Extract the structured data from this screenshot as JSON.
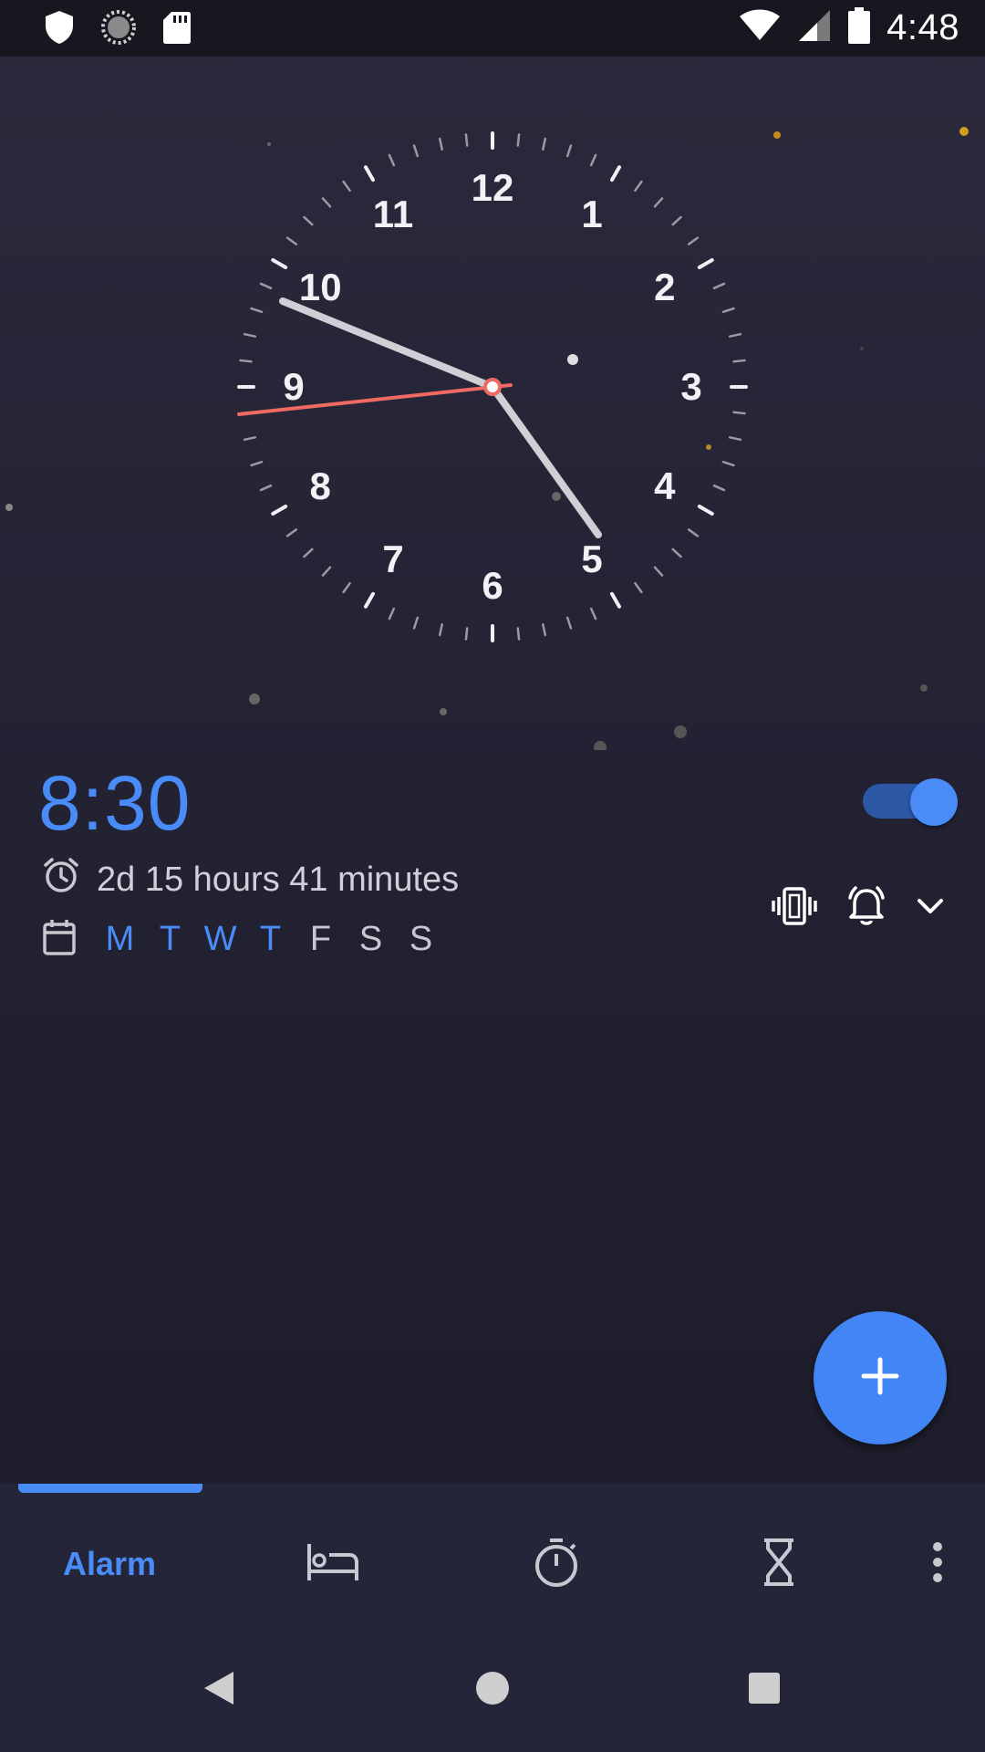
{
  "status_bar": {
    "time": "4:48",
    "left_icons": [
      "shield-icon",
      "sync-icon",
      "sd-card-icon"
    ],
    "right_icons": [
      "wifi-icon",
      "cell-signal-icon",
      "battery-icon"
    ]
  },
  "clock": {
    "numbers": [
      "12",
      "1",
      "2",
      "3",
      "4",
      "5",
      "6",
      "7",
      "8",
      "9",
      "10",
      "11"
    ],
    "hour_hand_color": "#cfcfd6",
    "second_hand_color": "#ef6a62"
  },
  "alarm": {
    "time": "8:30",
    "enabled": true,
    "remaining": "2d 15 hours 41 minutes",
    "days": [
      {
        "label": "M",
        "on": true
      },
      {
        "label": "T",
        "on": true
      },
      {
        "label": "W",
        "on": true
      },
      {
        "label": "T",
        "on": true
      },
      {
        "label": "F",
        "on": false
      },
      {
        "label": "S",
        "on": false
      },
      {
        "label": "S",
        "on": false
      }
    ],
    "actions": [
      "vibrate-icon",
      "alarm-bell-icon",
      "chevron-down-icon"
    ]
  },
  "fab": {
    "icon": "plus-icon"
  },
  "bottom_nav": {
    "alarm_label": "Alarm",
    "items": [
      "alarm",
      "bedtime-icon",
      "stopwatch-icon",
      "timer-icon",
      "more-icon"
    ]
  },
  "system_nav": [
    "back-icon",
    "home-icon",
    "recents-icon"
  ],
  "colors": {
    "accent": "#4a8cf7",
    "fab": "#4285f4",
    "background": "#222233",
    "nav": "#25253a"
  }
}
